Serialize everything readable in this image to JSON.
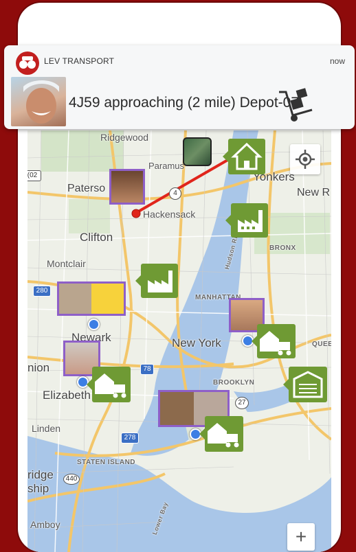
{
  "notification": {
    "app_name": "LEV TRANSPORT",
    "time": "now",
    "message": "4J59 approaching (2 mile) Depot-07"
  },
  "map": {
    "labels": [
      "Ridgewood",
      "Paramus",
      "Yonkers",
      "Paterso",
      "New R",
      "Hackensack",
      "Clifton",
      "BRONX",
      "Montclair",
      "MANHATTAN",
      "Newark",
      "New York",
      "QUEE",
      "nion",
      "BROOKLYN",
      "Elizabeth",
      "Linden",
      "STATEN ISLAND",
      "ridge",
      "ship",
      "Amboy",
      "Hudson River",
      "Lower Bay"
    ],
    "route_numbers": [
      "4",
      "280",
      "78",
      "278",
      "27",
      "440",
      "(02"
    ]
  },
  "controls": {
    "zoom_in_label": "+"
  },
  "colors": {
    "background": "#8e0b0b",
    "marker_green": "#6f9a34",
    "driver_border": "#8e5fc8",
    "route_arrow": "#e0251b",
    "location_dot": "#3c7ee4"
  },
  "icons": [
    "lev-transport-logo-icon",
    "hand-truck-icon",
    "house-icon",
    "factory-icon",
    "delivery-truck-icon",
    "warehouse-icon",
    "locate-me-icon",
    "plus-icon"
  ]
}
